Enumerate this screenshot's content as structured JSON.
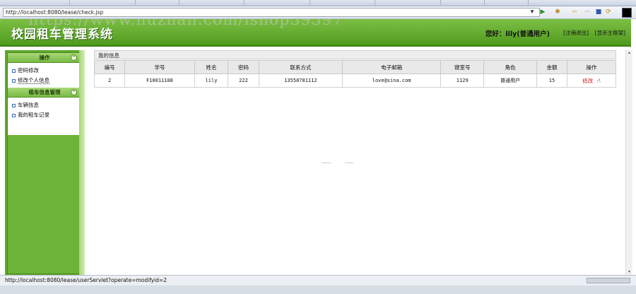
{
  "browser": {
    "address": "http://localhost:8080/lease/check.jsp",
    "status": "http://localhost:8080/lease/userServlet?operate=modifyid=2"
  },
  "header": {
    "title": "校园租车管理系统",
    "greeting": "您好：lily(普通用户)",
    "logout": "[注销退出]",
    "home": "[显示主框架]",
    "watermark": "https://www.huzhan.com/ishop39397"
  },
  "sidebar": {
    "sections": [
      {
        "title": "操作",
        "items": [
          "密码修改",
          "修改个人信息"
        ]
      },
      {
        "title": "租车信息管理",
        "items": [
          "车辆信息",
          "我的租车记录"
        ]
      }
    ]
  },
  "main": {
    "panel_title": "我的信息",
    "columns": [
      "编号",
      "学号",
      "姓名",
      "密码",
      "联系方式",
      "电子邮箱",
      "寝室号",
      "角色",
      "金额",
      "操作"
    ],
    "rows": [
      {
        "id": "2",
        "student_no": "F10011108",
        "name": "lily",
        "password": "222",
        "phone": "13558781112",
        "email": "love@sina.com",
        "dorm": "1129",
        "role": "普通用户",
        "amount": "15",
        "action": "修改"
      }
    ]
  },
  "colors": {
    "header_green": "#5ea82a",
    "link_red": "#d01a1a"
  }
}
